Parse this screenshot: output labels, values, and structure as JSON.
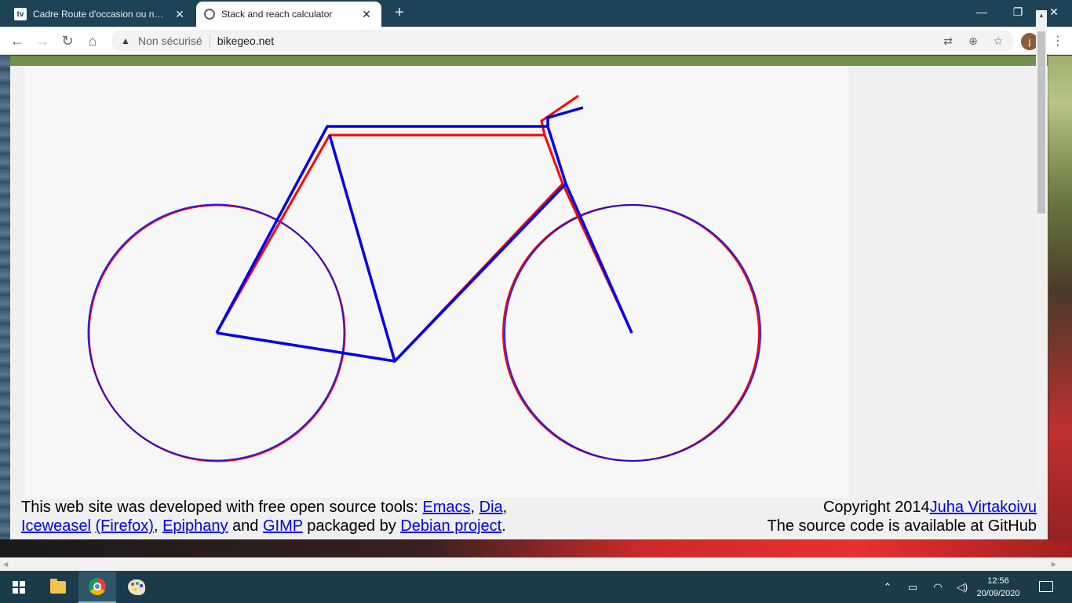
{
  "browser": {
    "tabs": [
      {
        "favicon": "tv",
        "title": "Cadre Route d'occasion ou neuf - ",
        "active": false
      },
      {
        "favicon": "globe",
        "title": "Stack and reach calculator",
        "active": true
      }
    ],
    "security_label": "Non sécurisé",
    "url": "bikegeo.net",
    "profile_initial": "j"
  },
  "icons": {
    "back": "←",
    "forward": "→",
    "reload": "↻",
    "home": "⌂",
    "close": "✕",
    "plus": "+",
    "minimize": "—",
    "restore": "❐",
    "warning": "▲",
    "translate": "⇄",
    "zoom": "⊕",
    "star": "☆",
    "menu": "⋮",
    "scroll_up": "▲",
    "scroll_left": "◀",
    "scroll_right": "▶",
    "tray_chevron": "⌃",
    "battery": "▭",
    "wifi": "◠",
    "volume": "◁)"
  },
  "colors": {
    "frame_a": "#0000ee",
    "frame_b": "#ff0000",
    "wheel": "#6a1fb0"
  },
  "footer": {
    "line1_prefix": "This web site was developed with free open source tools: ",
    "emacs": "Emacs",
    "comma1": ", ",
    "dia": "Dia",
    "comma2": ",",
    "iceweasel": "Iceweasel",
    "firefox": "(Firefox)",
    "comma3": ", ",
    "epiphany": "Epiphany",
    "and": " and ",
    "gimp": "GIMP",
    "packaged": " packaged by ",
    "debian": "Debian project",
    "period": ".",
    "copyright_prefix": "Copyright 2014",
    "author": "Juha Virtakoivu",
    "source_text": "The source code is available at GitHub"
  },
  "taskbar": {
    "time": "12:56",
    "date": "20/09/2020"
  }
}
